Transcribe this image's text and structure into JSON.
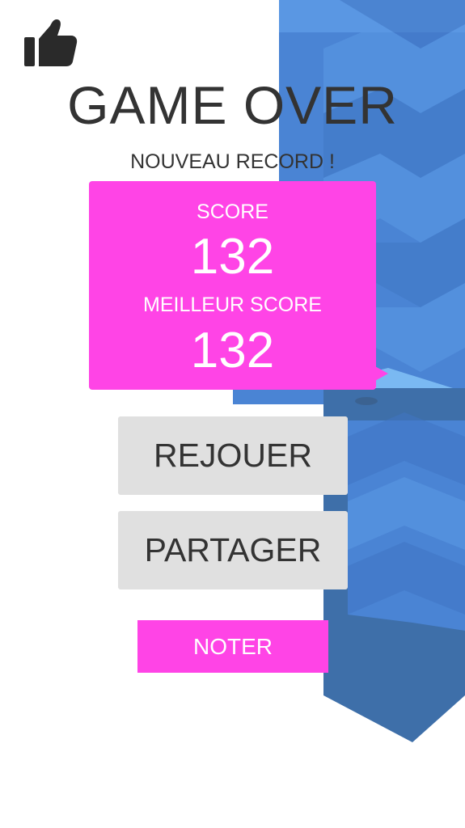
{
  "screen": {
    "title": "GAME OVER",
    "subtitle": "NOUVEAU RECORD !"
  },
  "score_panel": {
    "score_label": "SCORE",
    "score_value": "132",
    "best_label": "MEILLEUR SCORE",
    "best_value": "132"
  },
  "buttons": {
    "replay_label": "REJOUER",
    "share_label": "PARTAGER",
    "rate_label": "NOTER"
  },
  "icons": {
    "like": "thumbs-up-icon"
  },
  "colors": {
    "accent_pink": "#ff44e6",
    "button_grey": "#e0e0e0",
    "text_dark": "#333333",
    "zigzag_blue_light": "#5a97e3",
    "zigzag_blue_mid": "#4a84d4",
    "zigzag_blue_dark": "#3e6fa9",
    "background": "#ffffff"
  }
}
